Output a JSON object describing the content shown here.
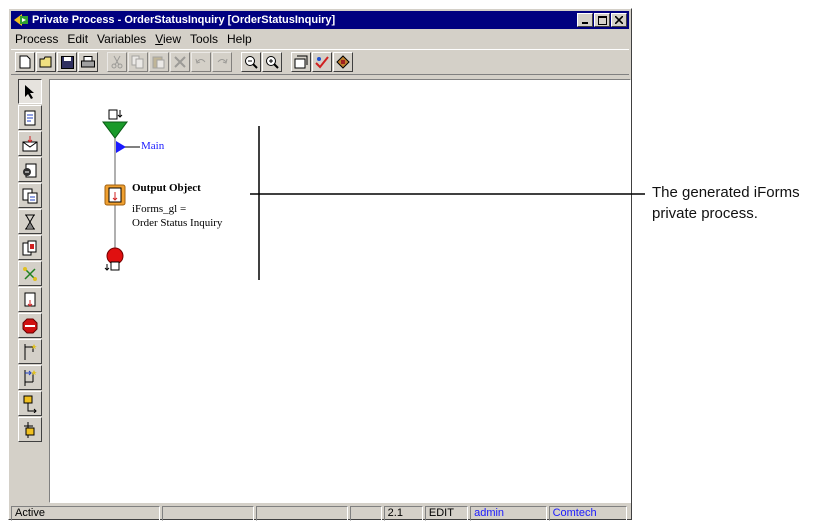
{
  "window": {
    "title": "Private Process - OrderStatusInquiry [OrderStatusInquiry]"
  },
  "menu": [
    "Process",
    "Edit",
    "Variables",
    "View",
    "Tools",
    "Help"
  ],
  "toolbar_icons": [
    "new-icon",
    "open-icon",
    "save-icon",
    "print-icon",
    "cut-icon",
    "copy-icon",
    "paste-icon",
    "delete-icon",
    "undo-icon",
    "redo-icon",
    "zoom-out-icon",
    "zoom-in-icon",
    "properties-icon",
    "validate-icon",
    "publish-icon"
  ],
  "palette_icons": [
    "pointer-icon",
    "document-icon",
    "receive-icon",
    "send-icon",
    "transform-icon",
    "timer-icon",
    "decision-icon",
    "parallel-icon",
    "output-object-icon",
    "stop-icon",
    "split-icon",
    "join-icon",
    "subprocess-icon",
    "move-icon"
  ],
  "diagram": {
    "main_label": "Main",
    "object_title": "Output Object",
    "object_line1": "iForms_gl =",
    "object_line2": "Order Status Inquiry"
  },
  "status": {
    "state": "Active",
    "field1": "",
    "field2": "",
    "field3": "",
    "version": "2.1",
    "mode": "EDIT",
    "user": "admin",
    "company": "Comtech"
  },
  "callout": {
    "line1": "The generated iForms",
    "line2": "private process."
  },
  "colors": {
    "title_bar": "#000080",
    "face": "#d4d0c8",
    "status_user": "#1a1aff"
  }
}
